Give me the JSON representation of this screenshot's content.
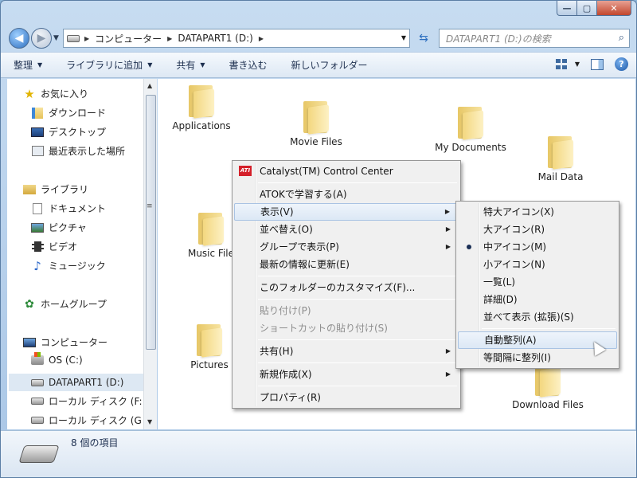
{
  "window": {
    "caption_min": "—",
    "caption_max": "▢",
    "caption_close": "✕"
  },
  "nav": {
    "back": "◀",
    "forward": "▶",
    "crumbs": [
      "コンピューター",
      "DATAPART1 (D:)"
    ],
    "search_placeholder": "DATAPART1 (D:)の検索"
  },
  "toolbar": {
    "items": [
      "整理",
      "ライブラリに追加",
      "共有",
      "書き込む",
      "新しいフォルダー"
    ]
  },
  "navpane": {
    "favorites": "お気に入り",
    "downloads": "ダウンロード",
    "desktop": "デスクトップ",
    "recent": "最近表示した場所",
    "libraries": "ライブラリ",
    "documents": "ドキュメント",
    "pictures": "ピクチャ",
    "videos": "ビデオ",
    "music": "ミュージック",
    "homegroup": "ホームグループ",
    "computer": "コンピューター",
    "os_c": "OS (C:)",
    "datapart_d": "DATAPART1 (D:)",
    "local_f": "ローカル ディスク (F:",
    "local_g": "ローカル ディスク (G"
  },
  "files": [
    "Applications",
    "Movie Files",
    "My Documents",
    "Mail Data",
    "Music File",
    "Pictures",
    "Download Files"
  ],
  "status": {
    "count": "8 個の項目"
  },
  "context_menu": {
    "catalyst": "Catalyst(TM) Control Center",
    "catalyst_icon": "ATI",
    "atok": "ATOKで学習する(A)",
    "view": "表示(V)",
    "sort": "並べ替え(O)",
    "group": "グループで表示(P)",
    "refresh": "最新の情報に更新(E)",
    "customize": "このフォルダーのカスタマイズ(F)...",
    "paste": "貼り付け(P)",
    "paste_shortcut": "ショートカットの貼り付け(S)",
    "share": "共有(H)",
    "new": "新規作成(X)",
    "properties": "プロパティ(R)"
  },
  "view_submenu": {
    "extra_large": "特大アイコン(X)",
    "large": "大アイコン(R)",
    "medium": "中アイコン(M)",
    "small": "小アイコン(N)",
    "list": "一覧(L)",
    "details": "詳細(D)",
    "tiles": "並べて表示 (拡張)(S)",
    "auto_arrange": "自動整列(A)",
    "align_grid": "等間隔に整列(I)"
  }
}
